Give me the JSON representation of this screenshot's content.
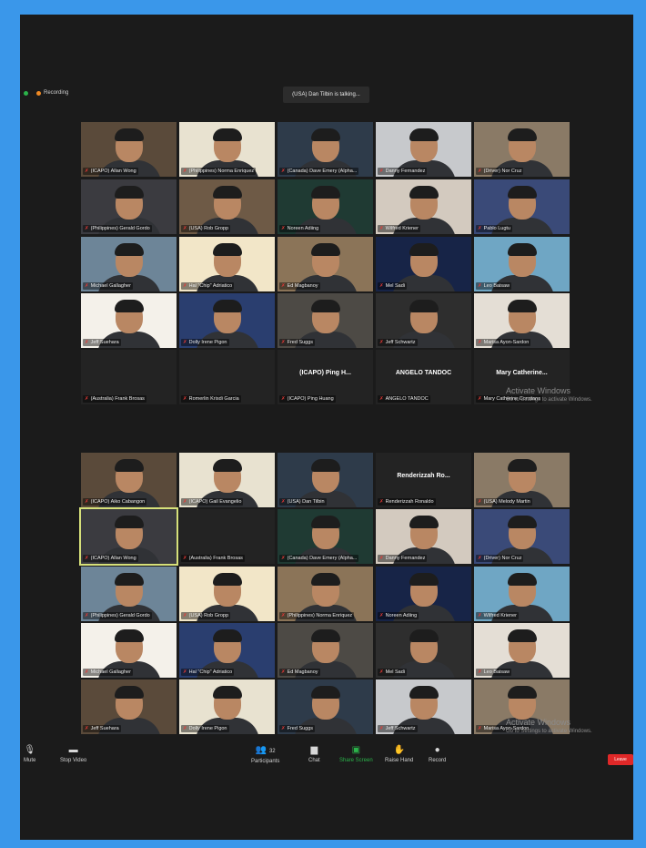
{
  "recording_label": "Recording",
  "talking_banner": "(USA) Dan Tilbin is talking...",
  "colors": {
    "background": "#1b1b1b",
    "frame": "#3a97ea",
    "share": "#2bb34a",
    "leave": "#e02828",
    "muted": "#e53935"
  },
  "grid1": [
    "(ICAPO) Allan Wong",
    "(Philippines) Norma Enriquez",
    "(Canada) Dave Emery (Alpha...",
    "Danny Fernandez",
    "(Driver) Nor Cruz",
    "(Philippines) Gerald Gordo",
    "(USA) Rob Gropp",
    "Noreen Adiing",
    "Wilfred Kriener",
    "Pablo Lugtu",
    "Michael Gallagher",
    "Hal \"Chip\" Adriatico",
    "Ed Magbanoy",
    "Mel Sadi",
    "Leo Baisaw",
    "Jeff Suehara",
    "Dolly Irene Pigon",
    "Fred Suggs",
    "Jeff Schwartz",
    "Marisa Ayon-Sardon",
    "(Australia) Frank Brosas",
    "Romerlin Krisdi Garcia",
    "(ICAPO) Ping Huang",
    "ANGELO TANDOC",
    "Mary Catherine Constans"
  ],
  "grid1_overlays": {
    "ping": "(ICAPO) Ping H...",
    "angelo": "ANGELO TANDOC",
    "mary": "Mary Catherine..."
  },
  "grid2": [
    "(ICAPO) Aiko Cabangon",
    "(ICAPO) Gail Evangelio",
    "(USA) Dan Tilbin",
    "Renderizzah Ronaldo",
    "(USA) Melody Martin",
    "(ICAPO) Allan Wong",
    "(Australia) Frank Brosas",
    "(Canada) Dave Emery (Alpha...",
    "Danny Fernandez",
    "(Driver) Nor Cruz",
    "(Philippines) Gerald Gordo",
    "(USA) Rob Gropp",
    "(Philippines) Norma Enriquez",
    "Noreen Adiing",
    "Wilfred Kriener",
    "Michael Gallagher",
    "Hal \"Chip\" Adriatico",
    "Ed Magbanoy",
    "Mel Sadi",
    "Leo Baisaw",
    "Jeff Suehara",
    "Dolly Irene Pigon",
    "Fred Suggs",
    "Jeff Schwartz",
    "Marisa Ayon-Sardon"
  ],
  "grid2_overlays": {
    "renderizzah": "Renderizzah Ro..."
  },
  "watermark": {
    "title": "Activate Windows",
    "sub": "Go to Settings to activate Windows."
  },
  "toolbar": {
    "mute": "Mute",
    "stop_video": "Stop Video",
    "participants": "Participants",
    "participant_count": "32",
    "chat": "Chat",
    "share_screen": "Share Screen",
    "raise_hand": "Raise Hand",
    "record": "Record",
    "leave": "Leave"
  }
}
